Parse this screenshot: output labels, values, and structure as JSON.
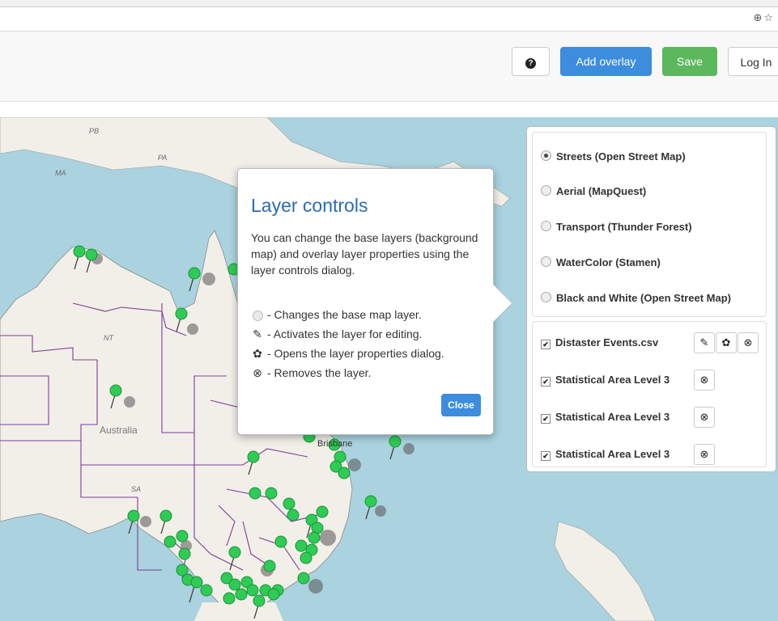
{
  "browser": {
    "toolbar_icons": "⊕☆"
  },
  "toolbar": {
    "help_label": "?",
    "add_overlay_label": "Add overlay",
    "save_label": "Save",
    "login_label": "Log In"
  },
  "map": {
    "labels": {
      "pb": "PB",
      "pa": "PA",
      "ma": "MA",
      "nt": "NT",
      "sa": "SA",
      "australia": "Australia",
      "brisbane": "Brisbane"
    },
    "colors": {
      "sea": "#aad3df",
      "land": "#f2efe9",
      "border": "#7b3f97",
      "marker": "#2ecc55"
    }
  },
  "popover": {
    "title": "Layer controls",
    "body": "You can change the base layers (background map) and overlay layer properties using the layer controls dialog.",
    "legend": [
      {
        "icon": "radio-icon",
        "text": "- Changes the base map layer."
      },
      {
        "icon": "edit-icon",
        "text": "- Activates the layer for editing."
      },
      {
        "icon": "gear-icon",
        "text": "- Opens the layer properties dialog."
      },
      {
        "icon": "remove-icon",
        "text": "- Removes the layer."
      }
    ],
    "close_label": "Close"
  },
  "layers": {
    "base": [
      {
        "label": "Streets (Open Street Map)",
        "selected": true
      },
      {
        "label": "Aerial (MapQuest)",
        "selected": false
      },
      {
        "label": "Transport (Thunder Forest)",
        "selected": false
      },
      {
        "label": "WaterColor (Stamen)",
        "selected": false
      },
      {
        "label": "Black and White (Open Street Map)",
        "selected": false
      }
    ],
    "overlays": [
      {
        "label": "Distaster Events.csv",
        "checked": true
      },
      {
        "label": "Statistical Area Level 3",
        "checked": true
      },
      {
        "label": "Statistical Area Level 3",
        "checked": true
      },
      {
        "label": "Statistical Area Level 3",
        "checked": true
      }
    ]
  }
}
